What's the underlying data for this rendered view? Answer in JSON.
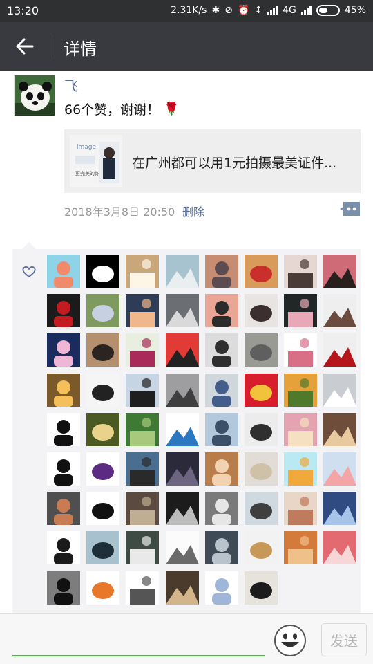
{
  "status_bar": {
    "time": "13:20",
    "speed": "2.31K/s",
    "network": "4G",
    "battery": "45%",
    "battery_level": 0.45,
    "icons": [
      "bluetooth-icon",
      "mute-icon",
      "alarm-icon",
      "signal-icon"
    ]
  },
  "header": {
    "title": "详情",
    "back_icon": "arrow-left-icon"
  },
  "post": {
    "author": "飞",
    "text": "66个赞，谢谢！",
    "emoji": "rose-icon",
    "link_card": {
      "title": "在广州都可以用1元拍摄最美证件...",
      "thumb_text": "image",
      "thumb_caption": "更完美的你"
    },
    "time": "2018年3月8日 20:50",
    "delete_label": "删除"
  },
  "likes": {
    "icon": "heart-icon",
    "avatars": [
      {
        "bg": "#8fd3e8",
        "fg": "#f08a6a"
      },
      {
        "bg": "#000000",
        "fg": "#ffffff"
      },
      {
        "bg": "#c9a77b",
        "fg": "#fdf5e6"
      },
      {
        "bg": "#a7c3cf",
        "fg": "#e9eef0"
      },
      {
        "bg": "#c78d73",
        "fg": "#5d4b52"
      },
      {
        "bg": "#d89b5a",
        "fg": "#c9302c"
      },
      {
        "bg": "#e7d7d2",
        "fg": "#4a3b36"
      },
      {
        "bg": "#cf6b77",
        "fg": "#2a1f1f"
      },
      {
        "bg": "#1b1b1b",
        "fg": "#c21b21"
      },
      {
        "bg": "#7f9a5e",
        "fg": "#c6d0e0"
      },
      {
        "bg": "#2f3c55",
        "fg": "#f1b78c"
      },
      {
        "bg": "#6b6e72",
        "fg": "#d9d9d9"
      },
      {
        "bg": "#e9a596",
        "fg": "#2b2b2b"
      },
      {
        "bg": "#e8e4e1",
        "fg": "#3b2f2f"
      },
      {
        "bg": "#212726",
        "fg": "#e9a8b8"
      },
      {
        "bg": "#eeeeee",
        "fg": "#6b4b3e"
      },
      {
        "bg": "#1a2b5f",
        "fg": "#f0b6d6"
      },
      {
        "bg": "#b5906f",
        "fg": "#2b2421"
      },
      {
        "bg": "#e9efe0",
        "fg": "#a82b59"
      },
      {
        "bg": "#e23a35",
        "fg": "#222222"
      },
      {
        "bg": "#dcdcdc",
        "fg": "#2f2f2f"
      },
      {
        "bg": "#9a9a94",
        "fg": "#5f5f5f"
      },
      {
        "bg": "#ffffff",
        "fg": "#d86f86"
      },
      {
        "bg": "#efefef",
        "fg": "#b4161c"
      },
      {
        "bg": "#7a5a2a",
        "fg": "#f5c05a"
      },
      {
        "bg": "#f5f5f5",
        "fg": "#222222"
      },
      {
        "bg": "#c7d4e3",
        "fg": "#1f1f1f"
      },
      {
        "bg": "#9e9ea0",
        "fg": "#3e3e3e"
      },
      {
        "bg": "#cfd7dd",
        "fg": "#435e8a"
      },
      {
        "bg": "#d81e2c",
        "fg": "#f3c23c"
      },
      {
        "bg": "#e7a13a",
        "fg": "#4f7a2b"
      },
      {
        "bg": "#c9ccd1",
        "fg": "#ffffff"
      },
      {
        "bg": "#ffffff",
        "fg": "#111111"
      },
      {
        "bg": "#4b5a22",
        "fg": "#e9d28a"
      },
      {
        "bg": "#3f7a34",
        "fg": "#a7c97b"
      },
      {
        "bg": "#ffffff",
        "fg": "#2b78c2"
      },
      {
        "bg": "#b3c8da",
        "fg": "#3c5169"
      },
      {
        "bg": "#ececec",
        "fg": "#2f2f2f"
      },
      {
        "bg": "#e3a3b0",
        "fg": "#f5e0c2"
      },
      {
        "bg": "#6e4d3b",
        "fg": "#e9c99f"
      },
      {
        "bg": "#ffffff",
        "fg": "#111111"
      },
      {
        "bg": "#ffffff",
        "fg": "#5b2a83"
      },
      {
        "bg": "#4a6e8f",
        "fg": "#2a2a2a"
      },
      {
        "bg": "#2b2a3a",
        "fg": "#6c6480"
      },
      {
        "bg": "#b87d4b",
        "fg": "#f2d2b0"
      },
      {
        "bg": "#e2dcd6",
        "fg": "#cfc0a8"
      },
      {
        "bg": "#b9eaf3",
        "fg": "#f0a93a"
      },
      {
        "bg": "#cfdff0",
        "fg": "#f4a6a6"
      },
      {
        "bg": "#4f4f4f",
        "fg": "#c97b54"
      },
      {
        "bg": "#ffffff",
        "fg": "#111111"
      },
      {
        "bg": "#5a4a3f",
        "fg": "#bfae93"
      },
      {
        "bg": "#1c1c1c",
        "fg": "#bcbcbc"
      },
      {
        "bg": "#7a7a7a",
        "fg": "#e6e6e6"
      },
      {
        "bg": "#d0d8e0",
        "fg": "#3f3f3f"
      },
      {
        "bg": "#e8d7c7",
        "fg": "#c07a5d"
      },
      {
        "bg": "#2f4b82",
        "fg": "#a6c3ea"
      },
      {
        "bg": "#ffffff",
        "fg": "#1b1b1b"
      },
      {
        "bg": "#a8c1cf",
        "fg": "#1f2f3a"
      },
      {
        "bg": "#3d4b44",
        "fg": "#e9e9e9"
      },
      {
        "bg": "#fbfbfb",
        "fg": "#6a6a6a"
      },
      {
        "bg": "#3e4a55",
        "fg": "#b9c3cc"
      },
      {
        "bg": "#f2f2f2",
        "fg": "#c89858"
      },
      {
        "bg": "#d47a3a",
        "fg": "#f0c08a"
      },
      {
        "bg": "#e36a70",
        "fg": "#f6d6d6"
      },
      {
        "bg": "#7d7d7d",
        "fg": "#111111"
      },
      {
        "bg": "#ffffff",
        "fg": "#e8772a"
      },
      {
        "bg": "#ffffff",
        "fg": "#555555"
      },
      {
        "bg": "#4a3b2c",
        "fg": "#d3b58b"
      },
      {
        "bg": "#ffffff",
        "fg": "#9fb6d8"
      },
      {
        "bg": "#e6e3dd",
        "fg": "#1c1c1c"
      }
    ]
  },
  "input": {
    "send_label": "发送",
    "emoji_icon": "smiley-icon"
  }
}
